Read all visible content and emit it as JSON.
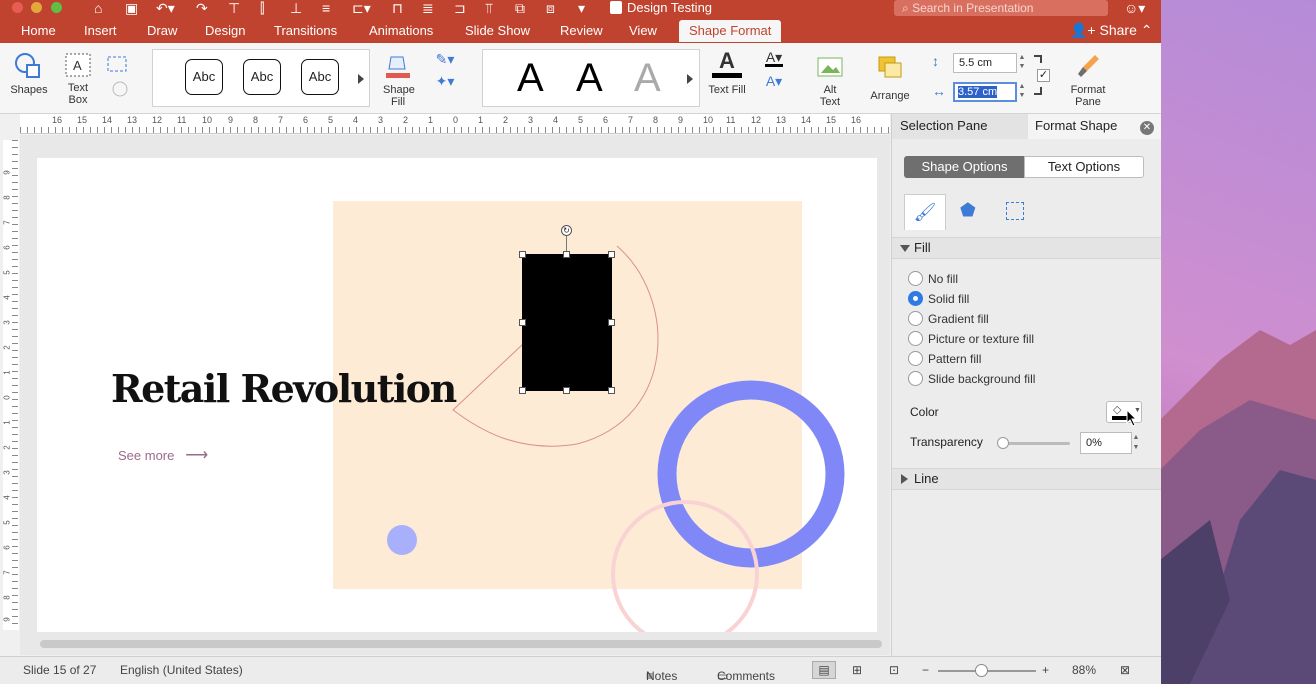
{
  "window": {
    "title": "Design Testing",
    "search_placeholder": "Search in Presentation",
    "share_label": "Share"
  },
  "tabs": [
    "Home",
    "Insert",
    "Draw",
    "Design",
    "Transitions",
    "Animations",
    "Slide Show",
    "Review",
    "View",
    "Shape Format"
  ],
  "active_tab": "Shape Format",
  "ribbon": {
    "shapes_label": "Shapes",
    "textbox_label": "Text Box",
    "style_sample": "Abc",
    "shape_fill_label": "Shape Fill",
    "wordart_sample": "A",
    "text_fill_label": "Text Fill",
    "alt_text_label": "Alt Text",
    "arrange_label": "Arrange",
    "height_value": "5.5 cm",
    "width_value": "3.57 cm",
    "format_pane_label": "Format Pane"
  },
  "ruler": {
    "h_numbers": [
      "16",
      "15",
      "14",
      "13",
      "12",
      "11",
      "10",
      "9",
      "8",
      "7",
      "6",
      "5",
      "4",
      "3",
      "2",
      "1",
      "0",
      "1",
      "2",
      "3",
      "4",
      "5",
      "6",
      "7",
      "8",
      "9",
      "10",
      "11",
      "12",
      "13",
      "14",
      "15",
      "16"
    ],
    "v_numbers": [
      "9",
      "8",
      "7",
      "6",
      "5",
      "4",
      "3",
      "2",
      "1",
      "0",
      "1",
      "2",
      "3",
      "4",
      "5",
      "6",
      "7",
      "8",
      "9"
    ]
  },
  "slide": {
    "title": "Retail Revolution",
    "link": "See more",
    "arrow": "⟶"
  },
  "pane": {
    "tab_selection": "Selection Pane",
    "tab_format": "Format Shape",
    "shape_options": "Shape Options",
    "text_options": "Text Options",
    "fill_section": "Fill",
    "fill_options": [
      "No fill",
      "Solid fill",
      "Gradient fill",
      "Picture or texture fill",
      "Pattern fill",
      "Slide background fill"
    ],
    "selected_fill": "Solid fill",
    "color_label": "Color",
    "transparency_label": "Transparency",
    "transparency_value": "0%",
    "line_section": "Line"
  },
  "status": {
    "slide_info": "Slide 15 of 27",
    "language": "English (United States)",
    "notes": "Notes",
    "comments": "Comments",
    "zoom": "88%"
  },
  "colors": {
    "accent": "#c0432f",
    "slide_bg_block": "#fdebd6",
    "ring": "#8088f7",
    "dot": "#a9b0fb"
  }
}
